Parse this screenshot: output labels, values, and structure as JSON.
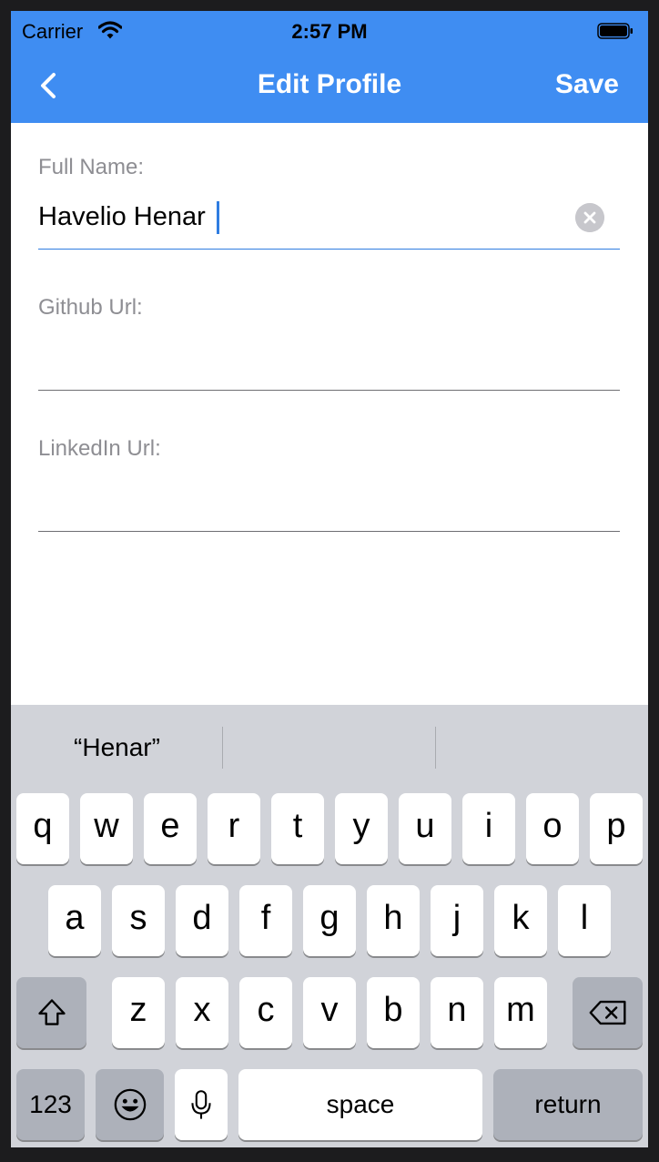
{
  "status_bar": {
    "carrier": "Carrier",
    "time": "2:57 PM"
  },
  "nav": {
    "title": "Edit Profile",
    "save_label": "Save"
  },
  "form": {
    "full_name": {
      "label": "Full Name:",
      "value": "Havelio Henar"
    },
    "github": {
      "label": "Github Url:",
      "value": ""
    },
    "linkedin": {
      "label": "LinkedIn Url:",
      "value": ""
    }
  },
  "keyboard": {
    "suggestions": [
      "“Henar”",
      "",
      ""
    ],
    "row1": [
      "q",
      "w",
      "e",
      "r",
      "t",
      "y",
      "u",
      "i",
      "o",
      "p"
    ],
    "row2": [
      "a",
      "s",
      "d",
      "f",
      "g",
      "h",
      "j",
      "k",
      "l"
    ],
    "row3": [
      "z",
      "x",
      "c",
      "v",
      "b",
      "n",
      "m"
    ],
    "numbers_label": "123",
    "space_label": "space",
    "return_label": "return"
  },
  "colors": {
    "accent": "#3f8df2",
    "keyboard_bg": "#d1d3d9"
  },
  "icons": [
    "wifi-icon",
    "battery-icon",
    "back-chevron-icon",
    "clear-icon",
    "shift-icon",
    "delete-icon",
    "emoji-icon",
    "microphone-icon"
  ]
}
